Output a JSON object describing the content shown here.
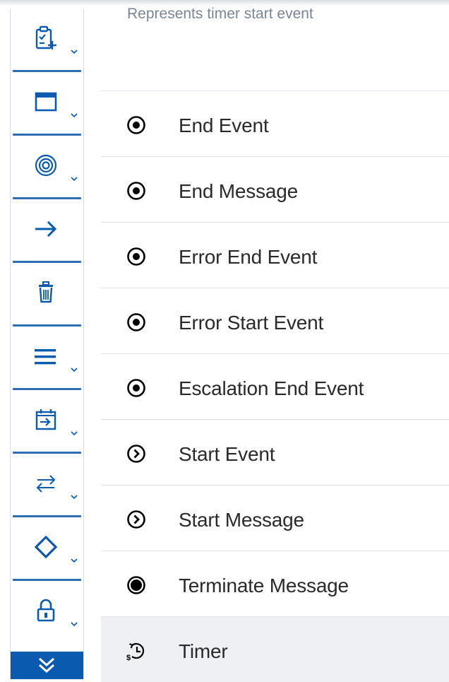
{
  "description": "Represents timer start event",
  "toolbar": {
    "tools": [
      {
        "name": "add-task-tool",
        "icon": "clipboard-add-icon",
        "dropdown": true
      },
      {
        "name": "window-tool",
        "icon": "browser-window-icon",
        "dropdown": true
      },
      {
        "name": "target-tool",
        "icon": "target-icon",
        "dropdown": true
      },
      {
        "name": "connector-tool",
        "icon": "arrow-right-icon",
        "dropdown": false
      },
      {
        "name": "delete-tool",
        "icon": "trash-icon",
        "dropdown": false
      },
      {
        "name": "menu-tool",
        "icon": "hamburger-icon",
        "dropdown": true
      },
      {
        "name": "calendar-tool",
        "icon": "calendar-import-icon",
        "dropdown": true
      },
      {
        "name": "swap-tool",
        "icon": "swap-arrows-icon",
        "dropdown": true
      },
      {
        "name": "gateway-tool",
        "icon": "diamond-icon",
        "dropdown": true
      },
      {
        "name": "lock-tool",
        "icon": "lock-icon",
        "dropdown": true
      }
    ],
    "expand_icon": "double-chevron-down-icon"
  },
  "events": [
    {
      "label": "End Event",
      "icon": "end-event-icon"
    },
    {
      "label": "End Message",
      "icon": "end-event-icon"
    },
    {
      "label": "Error End Event",
      "icon": "end-event-icon"
    },
    {
      "label": "Error Start Event",
      "icon": "end-event-icon"
    },
    {
      "label": "Escalation End Event",
      "icon": "end-event-icon"
    },
    {
      "label": "Start Event",
      "icon": "start-event-icon"
    },
    {
      "label": "Start Message",
      "icon": "start-event-icon"
    },
    {
      "label": "Terminate Message",
      "icon": "terminate-event-icon"
    },
    {
      "label": "Timer",
      "icon": "timer-icon",
      "selected": true
    }
  ],
  "colors": {
    "accent": "#0a5bb0",
    "icon_blue": "#0a5bb0",
    "separator": "#2f6db5",
    "selected_row": "#eef0f3",
    "description_text": "#7a8694"
  }
}
